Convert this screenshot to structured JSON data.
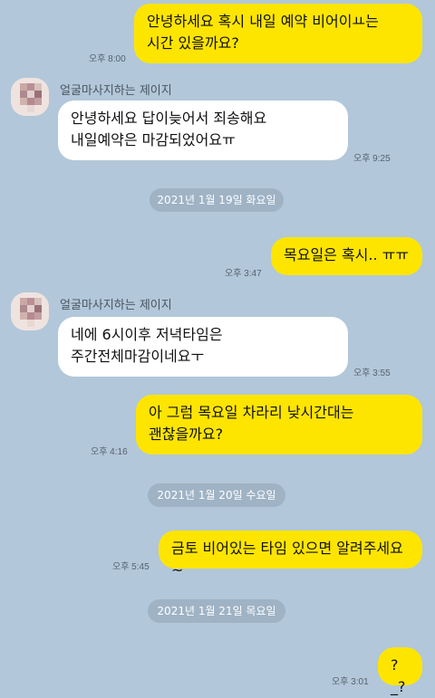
{
  "contact": {
    "name": "얼굴마사지하는 제이지"
  },
  "messages": [
    {
      "text": "안녕하세요 혹시 내일 예약 비어이ㅛ는 시간 있을까요?",
      "time": "오후 8:00"
    },
    {
      "text": "안녕하세요  답이늦어서 죄송해요  내일예약은 마감되었어요ㅠ",
      "time": "오후 9:25"
    },
    {
      "text": "목요일은 혹시.. ㅠㅠ",
      "time": "오후 3:47"
    },
    {
      "text": "네에 6시이후 저녁타임은 주간전체마감이네요ㅜ",
      "time": "오후 3:55"
    },
    {
      "text": "아 그럼 목요일 차라리 낮시간대는 괜찮을까요?",
      "time": "오후 4:16"
    },
    {
      "text": "금토 비어있는 타임 있으면 알려주세요~",
      "time": "오후 5:45"
    },
    {
      "text": "?_?",
      "time": "오후 3:01"
    }
  ],
  "dates": [
    "2021년 1월 19일 화요일",
    "2021년 1월 20일 수요일",
    "2021년 1월 21일 목요일"
  ],
  "colors": {
    "background": "#b2c7d9",
    "outgoing": "#fee500",
    "incoming": "#ffffff",
    "date_pill": "#9fb3c5"
  }
}
